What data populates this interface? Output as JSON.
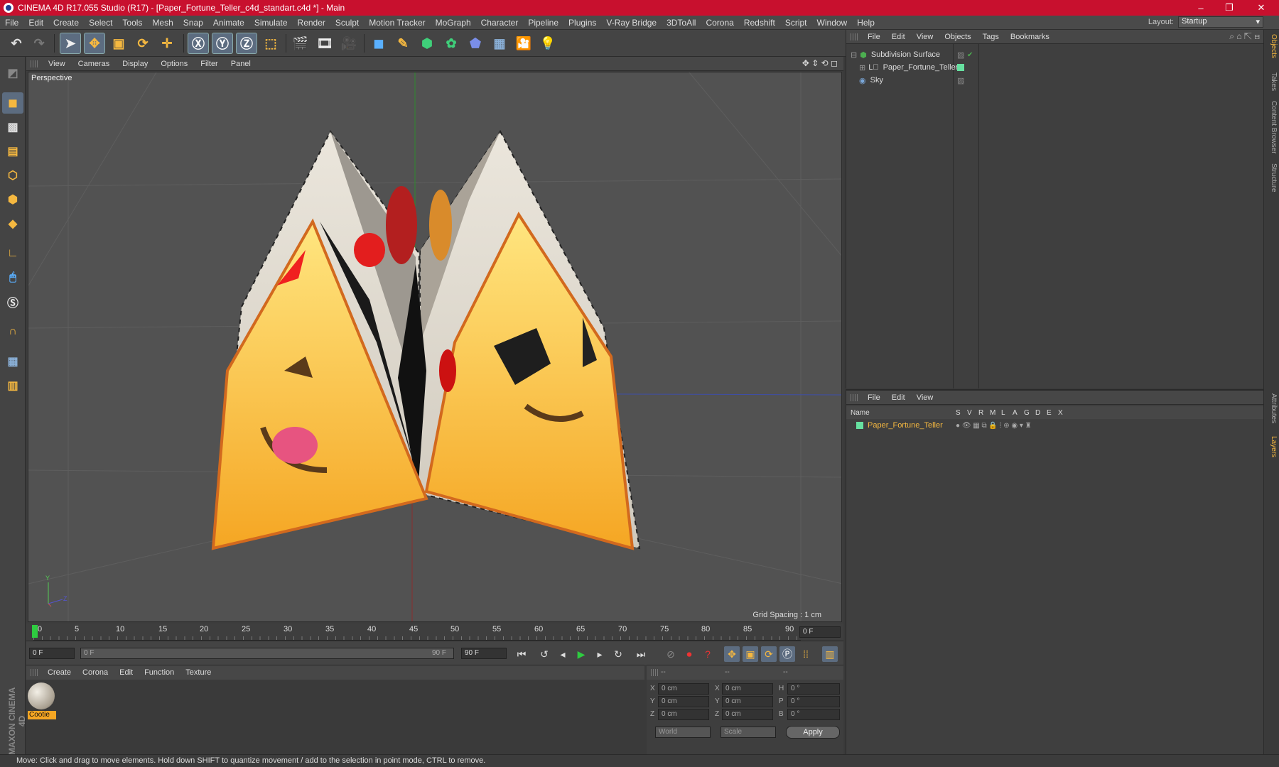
{
  "window": {
    "title": "CINEMA 4D R17.055 Studio (R17) - [Paper_Fortune_Teller_c4d_standart.c4d *] - Main",
    "min": "–",
    "max": "❐",
    "close": "✕"
  },
  "menu": [
    "File",
    "Edit",
    "Create",
    "Select",
    "Tools",
    "Mesh",
    "Snap",
    "Animate",
    "Simulate",
    "Render",
    "Sculpt",
    "Motion Tracker",
    "MoGraph",
    "Character",
    "Pipeline",
    "Plugins",
    "V-Ray Bridge",
    "3DToAll",
    "Corona",
    "Redshift",
    "Script",
    "Window",
    "Help"
  ],
  "layout": {
    "label": "Layout:",
    "value": "Startup"
  },
  "toolbar_icons": [
    "undo-icon",
    "redo-icon",
    "select-arrow-icon",
    "move-icon",
    "scale-icon",
    "rotate-icon",
    "transform-icon",
    "x-axis-icon",
    "y-axis-icon",
    "z-axis-icon",
    "world-coord-icon",
    "render-view-icon",
    "render-region-icon",
    "render-queue-icon",
    "cube-icon",
    "pen-icon",
    "subdivision-icon",
    "cloner-icon",
    "deformer-icon",
    "floor-icon",
    "camera-icon",
    "light-icon"
  ],
  "viewport": {
    "menu": [
      "View",
      "Cameras",
      "Display",
      "Options",
      "Filter",
      "Panel"
    ],
    "label": "Perspective",
    "grid_spacing": "Grid Spacing : 1 cm"
  },
  "timeline": {
    "ticks": [
      "0",
      "5",
      "10",
      "15",
      "20",
      "25",
      "30",
      "35",
      "40",
      "45",
      "50",
      "55",
      "60",
      "65",
      "70",
      "75",
      "80",
      "85",
      "90"
    ],
    "end_field": "0 F",
    "current": "0 F",
    "range_start": "0 F",
    "range_end": "90 F",
    "max_field": "90 F"
  },
  "materials": {
    "menu": [
      "Create",
      "Corona",
      "Edit",
      "Function",
      "Texture"
    ],
    "items": [
      {
        "name": "Cootie"
      }
    ]
  },
  "coords": {
    "headers": [
      "--",
      "--",
      "--"
    ],
    "rows": [
      {
        "a": "X",
        "av": "0 cm",
        "b": "X",
        "bv": "0 cm",
        "c": "H",
        "cv": "0 °"
      },
      {
        "a": "Y",
        "av": "0 cm",
        "b": "Y",
        "bv": "0 cm",
        "c": "P",
        "cv": "0 °"
      },
      {
        "a": "Z",
        "av": "0 cm",
        "b": "Z",
        "bv": "0 cm",
        "c": "B",
        "cv": "0 °"
      }
    ],
    "world": "World",
    "scale": "Scale",
    "apply": "Apply"
  },
  "object_manager": {
    "menu": [
      "File",
      "Edit",
      "View",
      "Objects",
      "Tags",
      "Bookmarks"
    ],
    "objects": [
      {
        "name": "Subdivision Surface",
        "color": "#4caf50"
      },
      {
        "name": "Paper_Fortune_Teller",
        "color": "#8cd"
      },
      {
        "name": "Sky",
        "color": "#7aa7d9"
      }
    ]
  },
  "layer_manager": {
    "menu": [
      "File",
      "Edit",
      "View"
    ],
    "columns": [
      "Name",
      "S",
      "V",
      "R",
      "M",
      "L",
      "A",
      "G",
      "D",
      "E",
      "X"
    ],
    "layers": [
      {
        "name": "Paper_Fortune_Teller",
        "color": "#66e0a0"
      }
    ]
  },
  "right_tabs": [
    "Objects",
    "Takes",
    "Content Browser",
    "Structure",
    "Attributes",
    "Layers"
  ],
  "status": "Move: Click and drag to move elements. Hold down SHIFT to quantize movement / add to the selection in point mode, CTRL to remove.",
  "brand": "MAXON CINEMA 4D"
}
